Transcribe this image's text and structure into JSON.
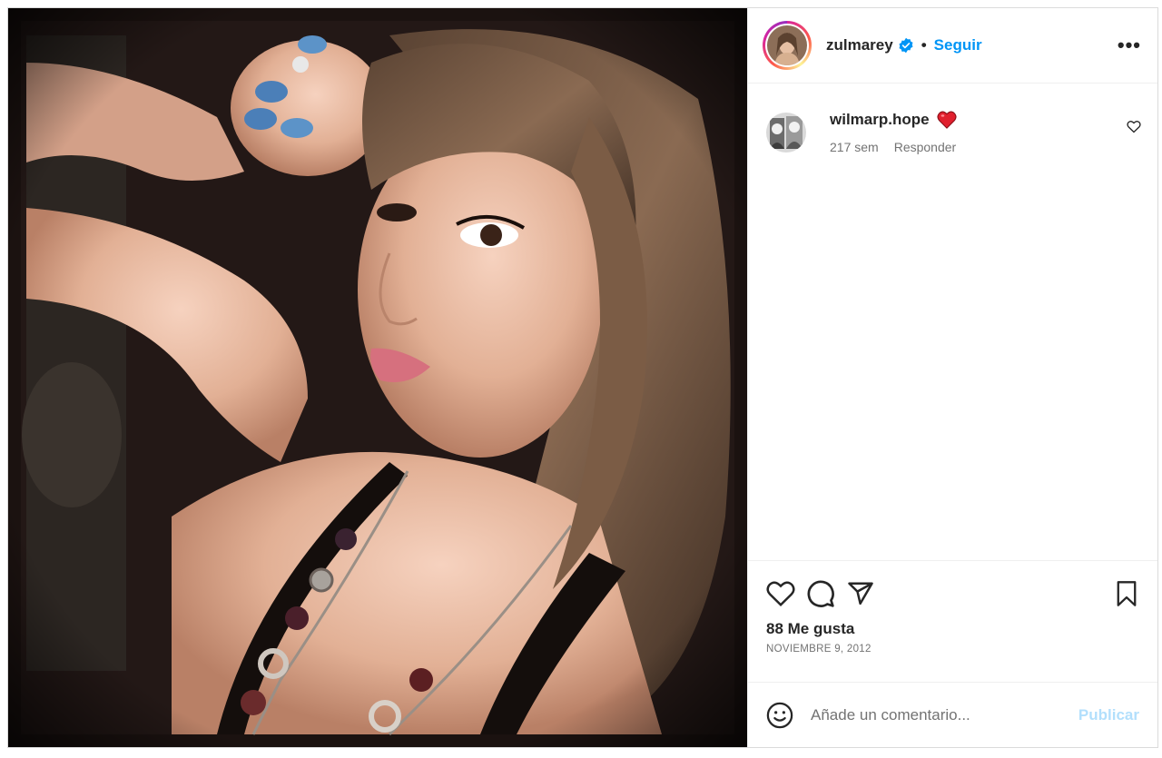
{
  "post": {
    "username": "zulmarey",
    "separator": "•",
    "follow_label": "Seguir",
    "more_label": "•••",
    "avatar_icon": "profile-photo",
    "verified_icon": "verified-badge-icon"
  },
  "comments": [
    {
      "username": "wilmarp.hope",
      "emoji_icon": "red-heart-emoji",
      "time": "217 sem",
      "reply_label": "Responder"
    }
  ],
  "actions": {
    "icons": [
      "heart-icon",
      "comment-icon",
      "share-icon",
      "bookmark-icon"
    ],
    "likes": "88 Me gusta",
    "date": "NOVIEMBRE 9, 2012"
  },
  "composer": {
    "placeholder": "Añade un comentario...",
    "publish_label": "Publicar"
  },
  "colors": {
    "accent": "#0095f6",
    "publish_disabled": "#b2dffc",
    "text": "#262626",
    "muted": "#737373",
    "border": "#dbdbdb"
  }
}
